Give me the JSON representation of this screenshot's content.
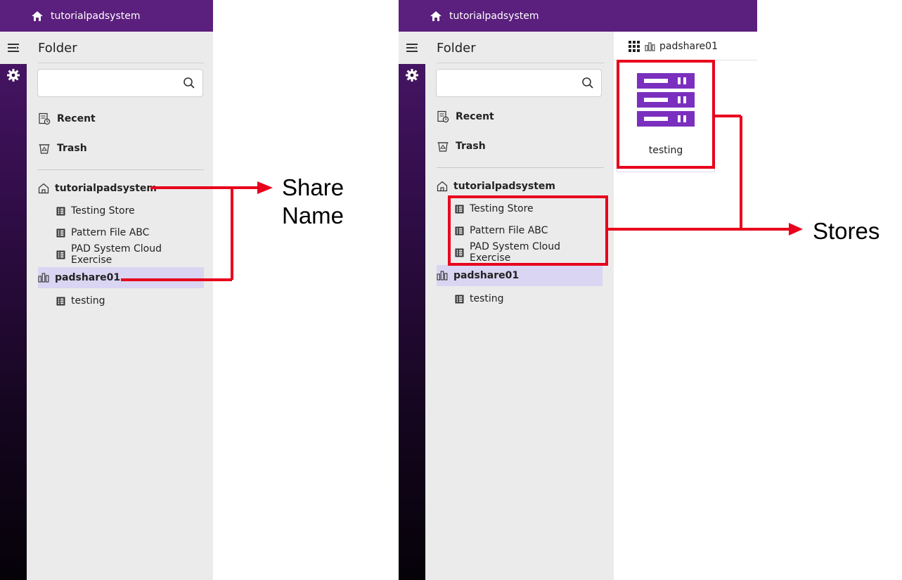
{
  "app": {
    "title": "tutorialpadsystem"
  },
  "sidebar": {
    "folder_title": "Folder",
    "search_placeholder": "",
    "nav": {
      "recent": "Recent",
      "trash": "Trash"
    },
    "tree": {
      "share1": {
        "label": "tutorialpadsystem",
        "icon": "home-outline-icon",
        "stores": [
          "Testing Store",
          "Pattern File ABC",
          "PAD System Cloud Exercise"
        ]
      },
      "share2": {
        "label": "padshare01",
        "icon": "share-bars-icon",
        "selected": true,
        "stores": [
          "testing"
        ]
      }
    }
  },
  "content": {
    "breadcrumb": "padshare01",
    "tiles": [
      {
        "label": "testing",
        "icon": "server-icon"
      }
    ]
  },
  "annotations": {
    "share_name_line1": "Share",
    "share_name_line2": "Name",
    "stores": "Stores"
  },
  "colors": {
    "topbar": "#5b1f7d",
    "selected_row": "#d9d5f2",
    "annotation_red": "#e8001c",
    "server_purple": "#7b2fbe"
  }
}
